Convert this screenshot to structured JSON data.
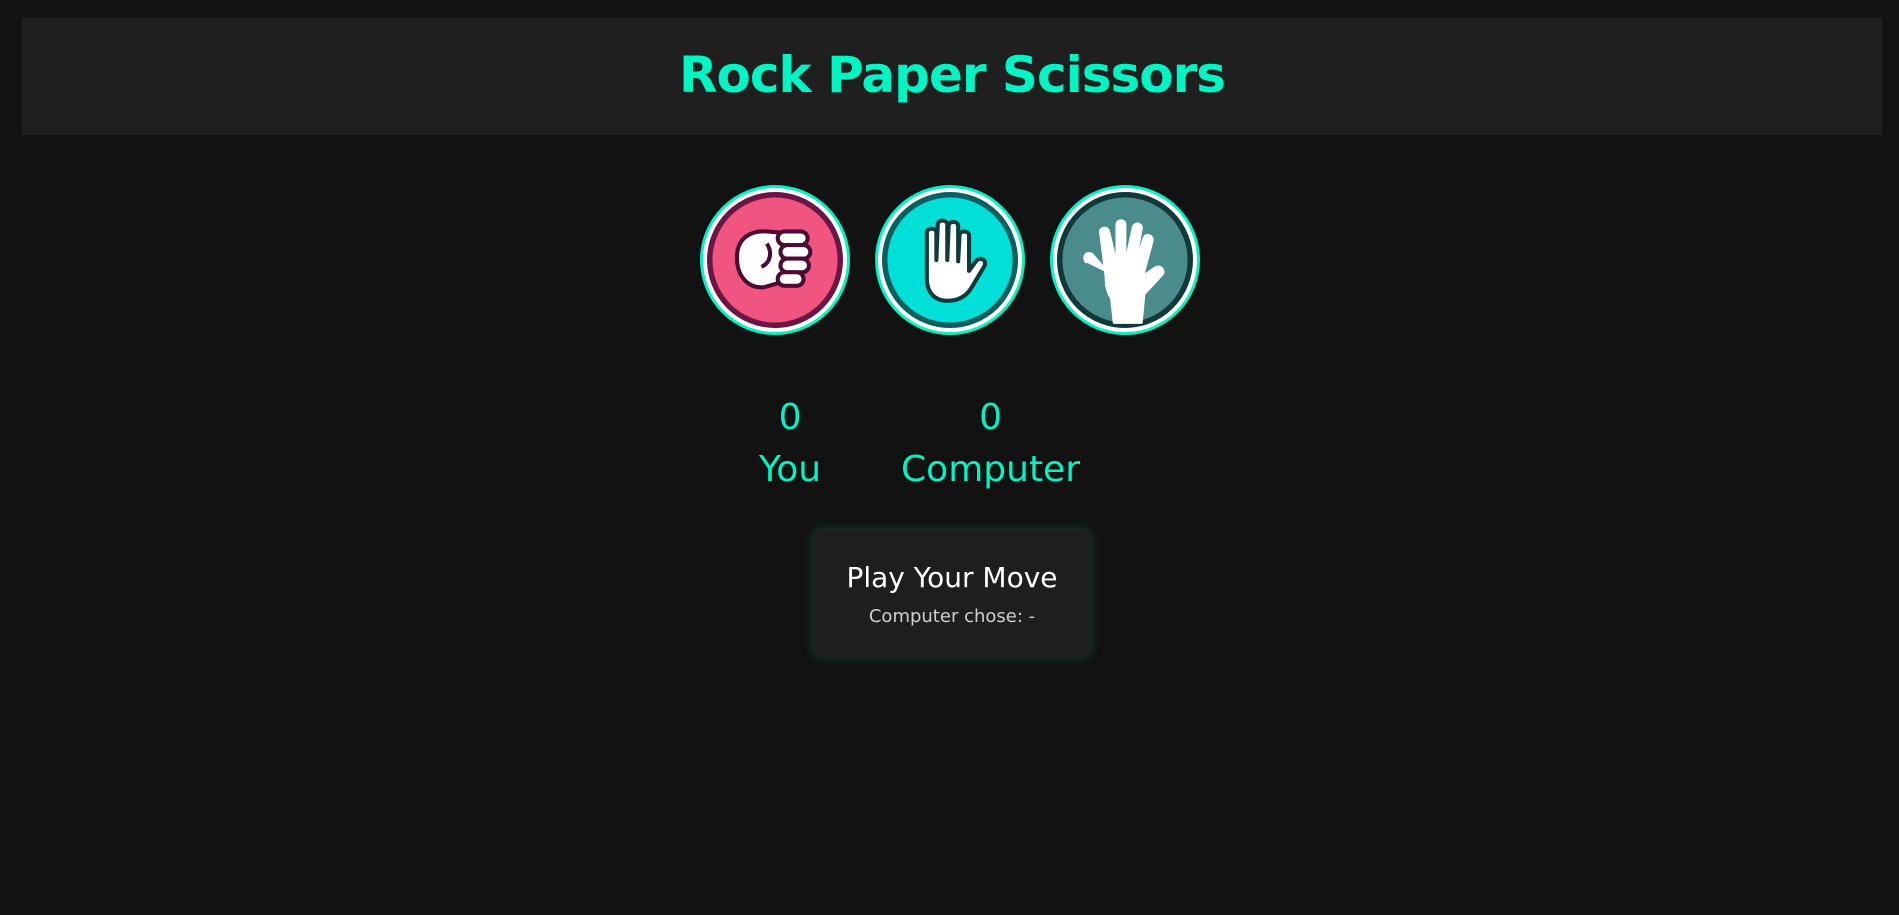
{
  "header": {
    "title": "Rock Paper Scissors"
  },
  "choices": [
    {
      "id": "rock",
      "icon": "fist-icon",
      "color": "#f0557f"
    },
    {
      "id": "paper",
      "icon": "open-hand-icon",
      "color": "#00dfd8"
    },
    {
      "id": "spock",
      "icon": "vulcan-salute-icon",
      "color": "#4a8c8c"
    }
  ],
  "scoreboard": {
    "user": {
      "score": "0",
      "label": "You"
    },
    "computer": {
      "score": "0",
      "label": "Computer"
    }
  },
  "message": {
    "text": "Play Your Move",
    "computer_choice": "Computer chose: -"
  },
  "colors": {
    "accent": "#00f5c4",
    "background": "#121212",
    "panel": "#1f1f1f"
  }
}
